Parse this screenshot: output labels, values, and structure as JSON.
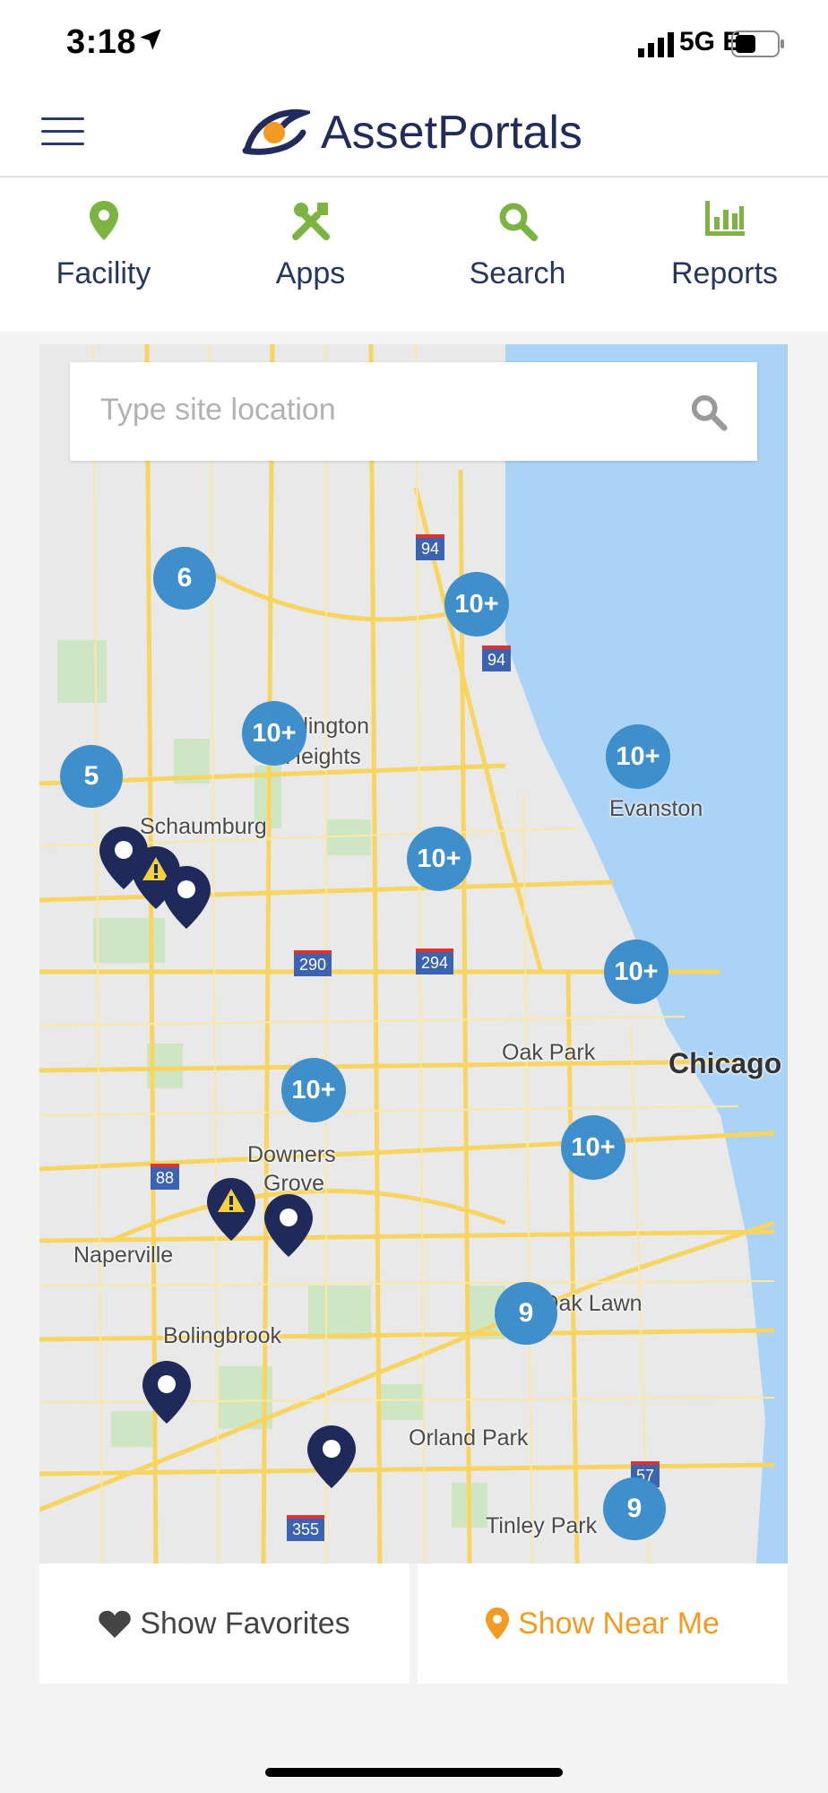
{
  "status_bar": {
    "time": "3:18",
    "network": "5G E"
  },
  "header": {
    "logo_text_bold": "Asset",
    "logo_text_rest": "Portals"
  },
  "nav": {
    "items": [
      {
        "label": "Facility",
        "icon": "map-pin-icon"
      },
      {
        "label": "Apps",
        "icon": "tools-icon"
      },
      {
        "label": "Search",
        "icon": "search-icon"
      },
      {
        "label": "Reports",
        "icon": "bar-chart-icon"
      }
    ]
  },
  "search": {
    "placeholder": "Type site location"
  },
  "map": {
    "clusters": [
      "6",
      "10+",
      "10+",
      "5",
      "10+",
      "10+",
      "10+",
      "10+",
      "10+",
      "9",
      "9"
    ],
    "labels": {
      "arlington": "rlington",
      "heights": "Heights",
      "schaumburg": "Schaumburg",
      "evanston": "Evanston",
      "oak_park": "Oak Park",
      "chicago": "Chicago",
      "downers": "Downers",
      "grove": "Grove",
      "naperville": "Naperville",
      "bolingbrook": "Bolingbrook",
      "oak_lawn": "Oak Lawn",
      "orland_park": "Orland Park",
      "tinley_park": "Tinley Park"
    },
    "highways": [
      "94",
      "94",
      "290",
      "294",
      "88",
      "355",
      "57"
    ]
  },
  "buttons": {
    "favorites": "Show Favorites",
    "near_me": "Show Near Me"
  },
  "colors": {
    "accent_green": "#7cb342",
    "navy": "#25365f",
    "cluster_blue": "#3e8fcb",
    "orange": "#f29b23",
    "water": "#aad3f5",
    "road": "#f7d560"
  }
}
